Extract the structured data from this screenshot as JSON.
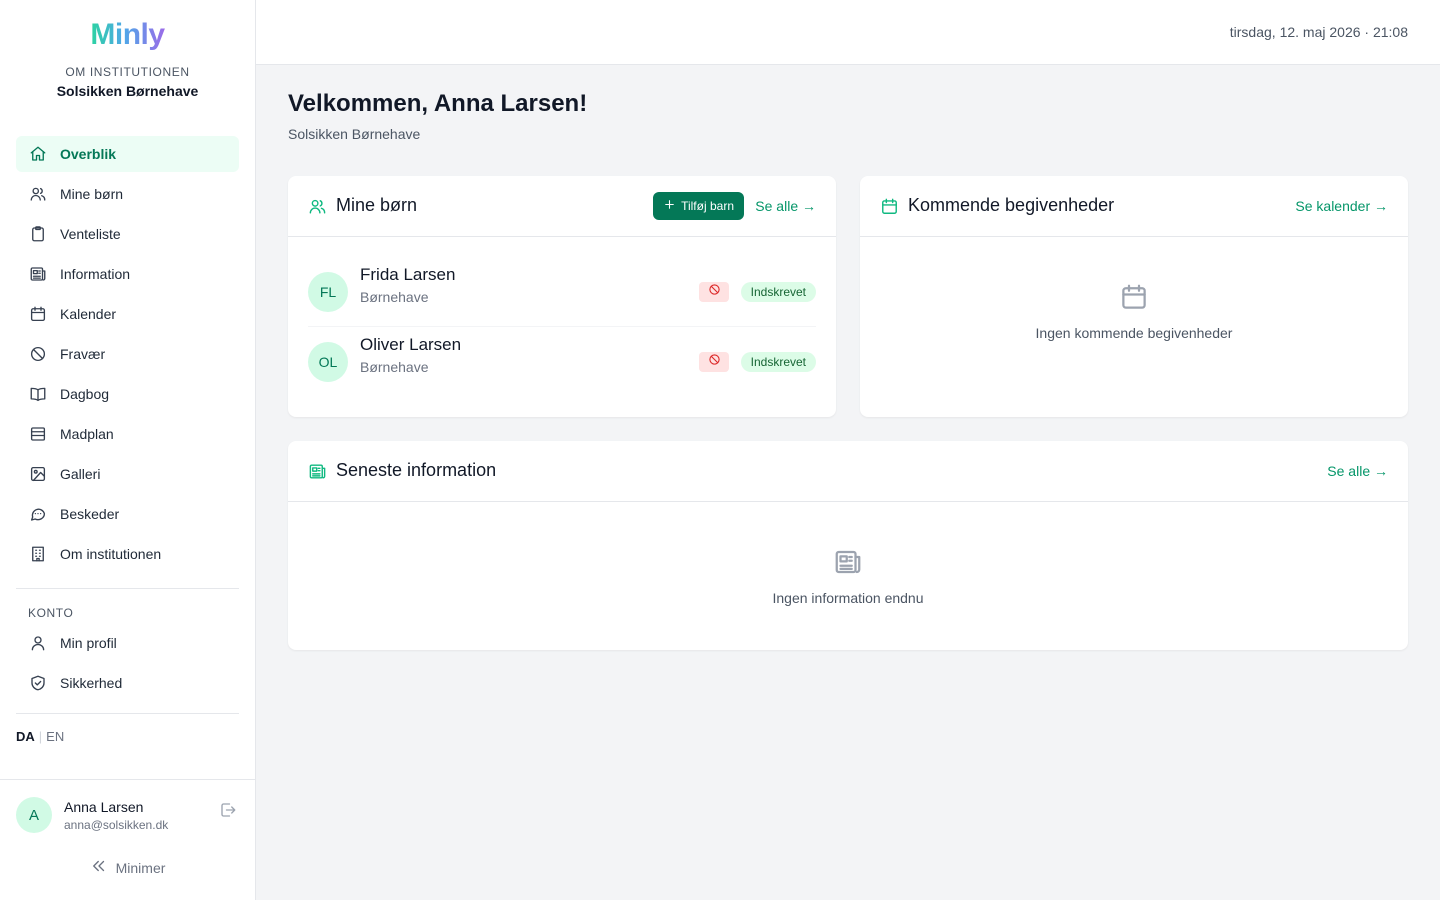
{
  "sidebar": {
    "logo": "Minly",
    "institution_label": "OM INSTITUTIONEN",
    "institution_name": "Solsikken Børnehave",
    "nav": [
      {
        "label": "Overblik",
        "icon": "home-icon",
        "active": true
      },
      {
        "label": "Mine børn",
        "icon": "users-icon"
      },
      {
        "label": "Venteliste",
        "icon": "clipboard-icon"
      },
      {
        "label": "Information",
        "icon": "newspaper-icon"
      },
      {
        "label": "Kalender",
        "icon": "calendar-icon"
      },
      {
        "label": "Fravær",
        "icon": "ban-icon"
      },
      {
        "label": "Dagbog",
        "icon": "book-icon"
      },
      {
        "label": "Madplan",
        "icon": "menu-stack-icon"
      },
      {
        "label": "Galleri",
        "icon": "image-icon"
      },
      {
        "label": "Beskeder",
        "icon": "chat-icon"
      },
      {
        "label": "Om institutionen",
        "icon": "building-icon"
      }
    ],
    "account_label": "KONTO",
    "account_nav": [
      {
        "label": "Min profil",
        "icon": "user-icon"
      },
      {
        "label": "Sikkerhed",
        "icon": "shield-icon"
      }
    ],
    "lang_current": "DA",
    "lang_other": "EN",
    "user": {
      "initial": "A",
      "name": "Anna Larsen",
      "email": "anna@solsikken.dk"
    },
    "minimize_label": "Minimer"
  },
  "topbar": {
    "datetime": "tirsdag, 12. maj 2026 · 21:08"
  },
  "main": {
    "welcome": "Velkommen, Anna Larsen!",
    "subtitle": "Solsikken Børnehave",
    "children_card": {
      "title": "Mine børn",
      "add_label": "Tilføj barn",
      "link": "Se alle →",
      "children": [
        {
          "initials": "FL",
          "name": "Frida Larsen",
          "group": "Børnehave",
          "status": "Indskrevet"
        },
        {
          "initials": "OL",
          "name": "Oliver Larsen",
          "group": "Børnehave",
          "status": "Indskrevet"
        }
      ]
    },
    "events_card": {
      "title": "Kommende begivenheder",
      "link": "Se kalender →",
      "empty": "Ingen kommende begivenheder"
    },
    "info_card": {
      "title": "Seneste information",
      "link": "Se alle →",
      "empty": "Ingen information endnu"
    }
  },
  "colors": {
    "accent": "#047857",
    "accent_light": "#d1fae5",
    "badge_red": "#fee2e2"
  }
}
